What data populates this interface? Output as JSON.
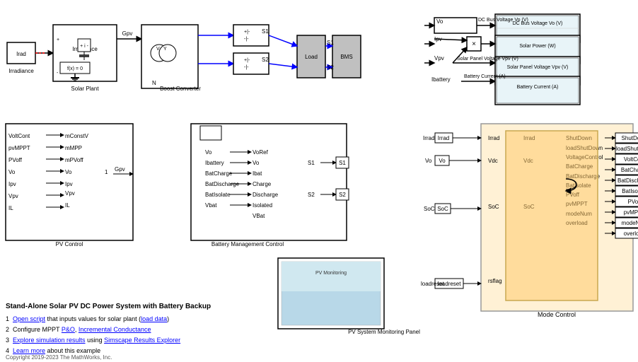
{
  "title": "Stand-Alone Solar PV DC Power System with Battery Backup",
  "blocks": {
    "irradiance": {
      "label": "Irrad",
      "sublabel": "Irradiance"
    },
    "solar_plant": {
      "label": "Solar Plant"
    },
    "boost_converter": {
      "label": "Boost Converter"
    },
    "bms": {
      "label": "BMS"
    },
    "load": {
      "label": "Load"
    },
    "pv_control": {
      "label": "PV Control"
    },
    "battery_mgmt": {
      "label": "Battery Management Control"
    },
    "mode_control": {
      "label": "Mode Control"
    },
    "pv_monitoring": {
      "label": "PV System Monitoring Panel"
    },
    "dc_bus_scope": {
      "label": "DC Bus Voltage Vo (V)"
    },
    "solar_power_scope": {
      "label": "Solar Power (W)"
    },
    "solar_panel_scope": {
      "label": "Solar Panel Voltage Vpv (V)"
    },
    "battery_current_scope": {
      "label": "Battery Current (A)"
    }
  },
  "footer": {
    "title": "Stand-Alone Solar PV DC Power System with Battery Backup",
    "items": [
      {
        "num": "1",
        "prefix": "Open script",
        "link1": "Open script",
        "mid": " that inputs values for solar plant (",
        "link2": "load data",
        "suffix": ")"
      },
      {
        "num": "2",
        "prefix": "Configure MPPT ",
        "link1": "P&O",
        "mid": ", ",
        "link2": "Incremental Conductance"
      },
      {
        "num": "3",
        "prefix": "Explore simulation results",
        "mid": " using ",
        "link1": "Simscape Results Explorer"
      },
      {
        "num": "4",
        "prefix": "Learn more",
        "mid": " about this example"
      }
    ],
    "copyright": "Copyright 2019-2023 The MathWorks, Inc."
  }
}
